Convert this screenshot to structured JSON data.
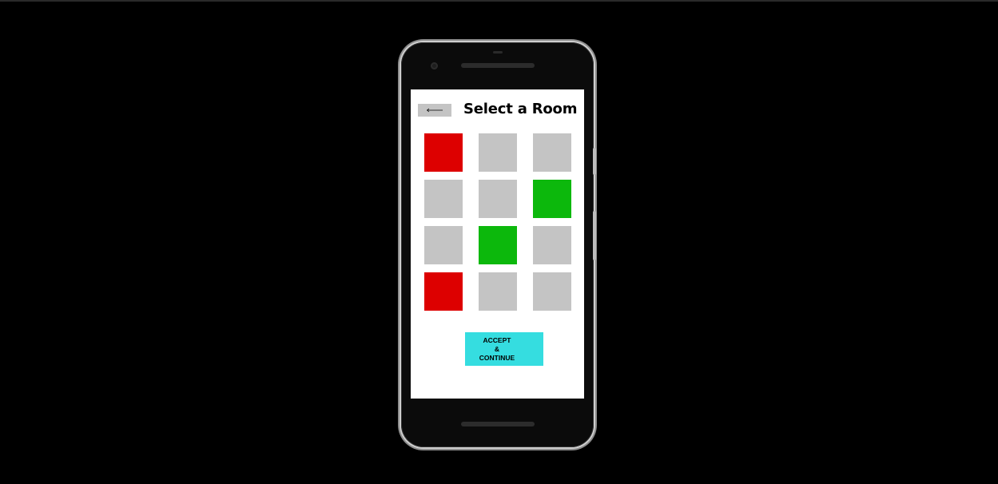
{
  "app": {
    "title": "Select a Room"
  },
  "header": {
    "back_icon": "arrow-left-icon",
    "title": "Select a Room"
  },
  "rooms": {
    "colors": {
      "unavailable": "#dd0000",
      "selected": "#0cb80c",
      "available": "#c4c4c4"
    },
    "grid": [
      [
        "unavailable",
        "available",
        "available"
      ],
      [
        "available",
        "available",
        "selected"
      ],
      [
        "available",
        "selected",
        "available"
      ],
      [
        "unavailable",
        "available",
        "available"
      ]
    ]
  },
  "footer": {
    "accept_label": "ACCEPT\n&\nCONTINUE",
    "accept_color": "#35dde0"
  }
}
